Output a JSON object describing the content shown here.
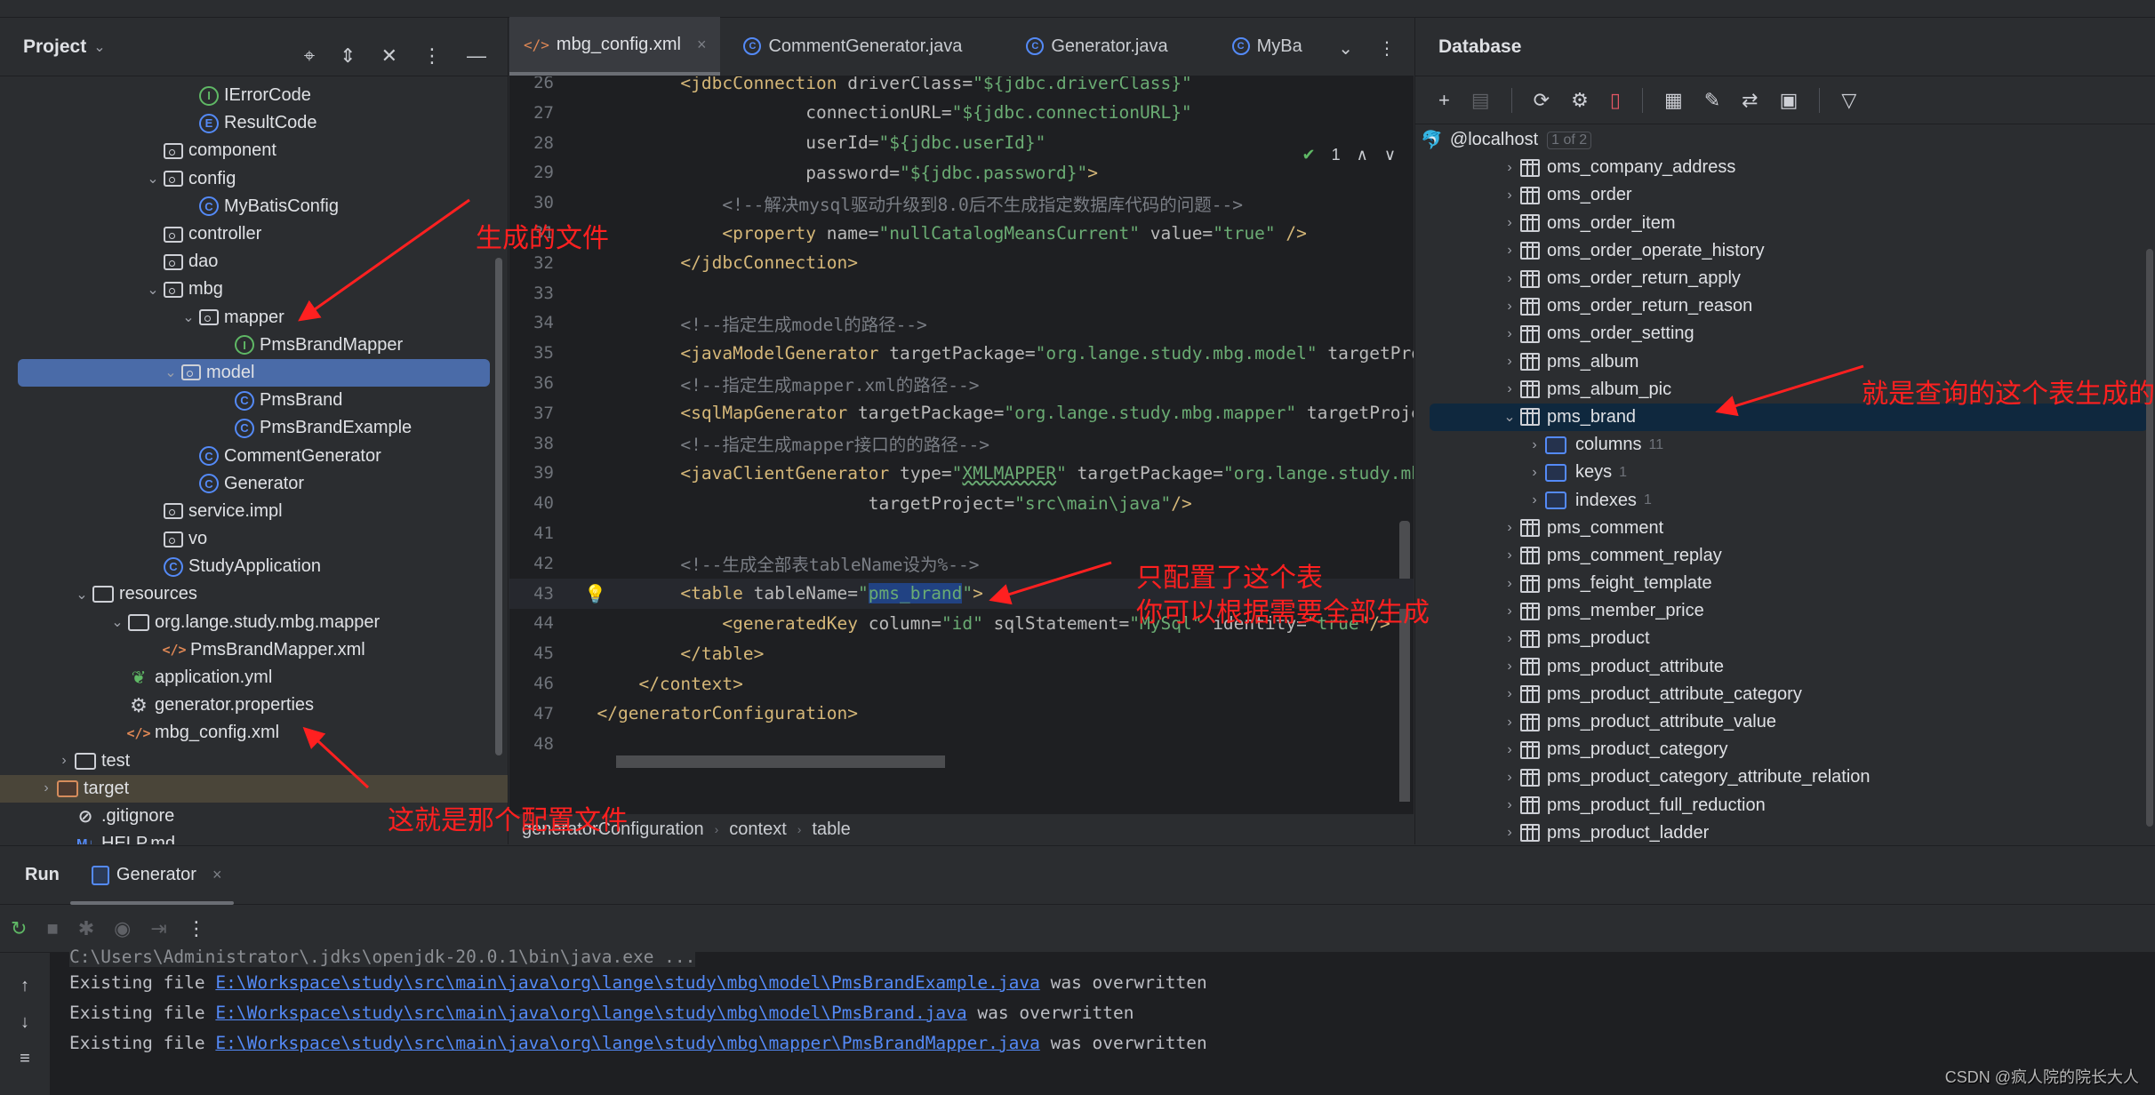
{
  "project_panel": {
    "title": "Project",
    "tree": [
      {
        "label": "IErrorCode",
        "icon": "interface-icon",
        "glyph": "I",
        "depth": 4,
        "arrow": ""
      },
      {
        "label": "ResultCode",
        "icon": "enum-icon",
        "glyph": "E",
        "depth": 4,
        "arrow": ""
      },
      {
        "label": "component",
        "icon": "package-icon",
        "depth": 3,
        "arrow": ""
      },
      {
        "label": "config",
        "icon": "package-icon",
        "depth": 3,
        "arrow": "down"
      },
      {
        "label": "MyBatisConfig",
        "icon": "class-icon",
        "glyph": "C",
        "depth": 4,
        "arrow": ""
      },
      {
        "label": "controller",
        "icon": "package-icon",
        "depth": 3,
        "arrow": ""
      },
      {
        "label": "dao",
        "icon": "package-icon",
        "depth": 3,
        "arrow": ""
      },
      {
        "label": "mbg",
        "icon": "package-icon",
        "depth": 3,
        "arrow": "down"
      },
      {
        "label": "mapper",
        "icon": "package-icon",
        "depth": 4,
        "arrow": "down"
      },
      {
        "label": "PmsBrandMapper",
        "icon": "interface-icon",
        "glyph": "I",
        "depth": 5,
        "arrow": ""
      },
      {
        "label": "model",
        "icon": "package-icon",
        "depth": 4,
        "arrow": "down",
        "selected": true
      },
      {
        "label": "PmsBrand",
        "icon": "class-icon",
        "glyph": "C",
        "depth": 5,
        "arrow": ""
      },
      {
        "label": "PmsBrandExample",
        "icon": "class-icon",
        "glyph": "C",
        "depth": 5,
        "arrow": ""
      },
      {
        "label": "CommentGenerator",
        "icon": "class-icon",
        "glyph": "C",
        "depth": 4,
        "arrow": ""
      },
      {
        "label": "Generator",
        "icon": "class-icon",
        "glyph": "C",
        "depth": 4,
        "arrow": ""
      },
      {
        "label": "service.impl",
        "icon": "package-icon",
        "depth": 3,
        "arrow": ""
      },
      {
        "label": "vo",
        "icon": "package-icon",
        "depth": 3,
        "arrow": ""
      },
      {
        "label": "StudyApplication",
        "icon": "spring-class-icon",
        "glyph": "C",
        "depth": 3,
        "arrow": ""
      },
      {
        "label": "resources",
        "icon": "resources-folder-icon",
        "depth": 1,
        "arrow": "down"
      },
      {
        "label": "org.lange.study.mbg.mapper",
        "icon": "folder-icon",
        "depth": 2,
        "arrow": "down"
      },
      {
        "label": "PmsBrandMapper.xml",
        "icon": "xml-file-icon",
        "depth": 3,
        "arrow": ""
      },
      {
        "label": "application.yml",
        "icon": "spring-yml-icon",
        "depth": 2,
        "arrow": ""
      },
      {
        "label": "generator.properties",
        "icon": "properties-gear-icon",
        "depth": 2,
        "arrow": ""
      },
      {
        "label": "mbg_config.xml",
        "icon": "xml-file-icon",
        "depth": 2,
        "arrow": ""
      },
      {
        "label": "test",
        "icon": "folder-icon",
        "depth": 0.5,
        "arrow": "right"
      },
      {
        "label": "target",
        "icon": "excluded-folder-icon",
        "depth": 0,
        "arrow": "right",
        "target": true
      },
      {
        "label": ".gitignore",
        "icon": "ignore-file-icon",
        "depth": 0.5,
        "arrow": ""
      },
      {
        "label": "HELP.md",
        "icon": "markdown-icon",
        "depth": 0.5,
        "arrow": ""
      }
    ]
  },
  "editor": {
    "tabs": [
      {
        "label": "mbg_config.xml",
        "icon": "xml-file-icon",
        "active": true,
        "closable": true
      },
      {
        "label": "CommentGenerator.java",
        "icon": "class-icon",
        "active": false
      },
      {
        "label": "Generator.java",
        "icon": "class-icon",
        "active": false
      },
      {
        "label": "MyBa",
        "icon": "class-icon",
        "active": false
      }
    ],
    "inspection_count": "1",
    "current_line": 43,
    "lines": [
      {
        "n": "26",
        "indent": 2,
        "segs": [
          [
            "tag",
            "<jdbcConnection "
          ],
          [
            "attr",
            "driverClass="
          ],
          [
            "str",
            "\"${jdbc.driverClass}\""
          ]
        ]
      },
      {
        "n": "27",
        "indent": 0,
        "pad": "                    ",
        "segs": [
          [
            "attr",
            "connectionURL="
          ],
          [
            "str",
            "\"${jdbc.connectionURL}\""
          ]
        ]
      },
      {
        "n": "28",
        "indent": 0,
        "pad": "                    ",
        "segs": [
          [
            "attr",
            "userId="
          ],
          [
            "str",
            "\"${jdbc.userId}\""
          ]
        ]
      },
      {
        "n": "29",
        "indent": 0,
        "pad": "                    ",
        "segs": [
          [
            "attr",
            "password="
          ],
          [
            "str",
            "\"${jdbc.password}\""
          ],
          [
            "tag",
            ">"
          ]
        ]
      },
      {
        "n": "30",
        "indent": 3,
        "segs": [
          [
            "cmt",
            "<!--解决mysql驱动升级到8.0后不生成指定数据库代码的问题-->"
          ]
        ]
      },
      {
        "n": "31",
        "indent": 3,
        "segs": [
          [
            "tag",
            "<property "
          ],
          [
            "attr",
            "name="
          ],
          [
            "str",
            "\"nullCatalogMeansCurrent\" "
          ],
          [
            "attr",
            "value="
          ],
          [
            "str",
            "\"true\" "
          ],
          [
            "tag",
            "/>"
          ]
        ]
      },
      {
        "n": "32",
        "indent": 2,
        "segs": [
          [
            "tag",
            "</jdbcConnection>"
          ]
        ]
      },
      {
        "n": "33",
        "indent": 0,
        "segs": []
      },
      {
        "n": "34",
        "indent": 2,
        "segs": [
          [
            "cmt",
            "<!--指定生成model的路径-->"
          ]
        ]
      },
      {
        "n": "35",
        "indent": 2,
        "segs": [
          [
            "tag",
            "<javaModelGenerator "
          ],
          [
            "attr",
            "targetPackage="
          ],
          [
            "str",
            "\"org.lange.study.mbg.model\" "
          ],
          [
            "attr",
            "targetProject=\"src\\main\\java\"/>"
          ]
        ]
      },
      {
        "n": "36",
        "indent": 2,
        "segs": [
          [
            "cmt",
            "<!--指定生成mapper.xml的路径-->"
          ]
        ]
      },
      {
        "n": "37",
        "indent": 2,
        "segs": [
          [
            "tag",
            "<sqlMapGenerator "
          ],
          [
            "attr",
            "targetPackage="
          ],
          [
            "str",
            "\"org.lange.study.mbg.mapper\" "
          ],
          [
            "attr",
            "targetProject=\"src\\main\\resources\"/>"
          ]
        ]
      },
      {
        "n": "38",
        "indent": 2,
        "segs": [
          [
            "cmt",
            "<!--指定生成mapper接口的的路径-->"
          ]
        ]
      },
      {
        "n": "39",
        "indent": 2,
        "segs": [
          [
            "tag",
            "<javaClientGenerator "
          ],
          [
            "attr",
            "type="
          ],
          [
            "str",
            "\""
          ],
          [
            "squig",
            "XMLMAPPER"
          ],
          [
            "str",
            "\" "
          ],
          [
            "attr",
            "targetPackage="
          ],
          [
            "str",
            "\"org.lange.study.mbg.mapper\""
          ]
        ]
      },
      {
        "n": "40",
        "indent": 0,
        "pad": "                          ",
        "segs": [
          [
            "attr",
            "targetProject="
          ],
          [
            "str",
            "\"src\\main\\java\""
          ],
          [
            "tag",
            "/>"
          ]
        ]
      },
      {
        "n": "41",
        "indent": 0,
        "segs": []
      },
      {
        "n": "42",
        "indent": 2,
        "segs": [
          [
            "cmt",
            "<!--生成全部表tableName设为%-->"
          ]
        ]
      },
      {
        "n": "43",
        "indent": 2,
        "segs": [
          [
            "tag",
            "<table "
          ],
          [
            "attr",
            "tableName="
          ],
          [
            "str",
            "\""
          ],
          [
            "sel",
            "pms_brand"
          ],
          [
            "str",
            "\""
          ],
          [
            "tag",
            ">"
          ]
        ]
      },
      {
        "n": "44",
        "indent": 3,
        "segs": [
          [
            "tag",
            "<generatedKey "
          ],
          [
            "attr",
            "column="
          ],
          [
            "str",
            "\"id\" "
          ],
          [
            "attr",
            "sqlStatement="
          ],
          [
            "str",
            "\"MySql\" "
          ],
          [
            "attr",
            "identity="
          ],
          [
            "str",
            "\"true\""
          ],
          [
            "tag",
            "/>"
          ]
        ]
      },
      {
        "n": "45",
        "indent": 2,
        "segs": [
          [
            "tag",
            "</table>"
          ]
        ]
      },
      {
        "n": "46",
        "indent": 1,
        "segs": [
          [
            "tag",
            "</context>"
          ]
        ]
      },
      {
        "n": "47",
        "indent": 0,
        "segs": [
          [
            "tag",
            "</generatorConfiguration>"
          ]
        ]
      },
      {
        "n": "48",
        "indent": 0,
        "segs": []
      }
    ],
    "breadcrumb": [
      "generatorConfiguration",
      "context",
      "table"
    ]
  },
  "database_panel": {
    "title": "Database",
    "connection": "@localhost",
    "connection_badge": "1 of 2",
    "tables": [
      {
        "label": "oms_company_address"
      },
      {
        "label": "oms_order"
      },
      {
        "label": "oms_order_item"
      },
      {
        "label": "oms_order_operate_history"
      },
      {
        "label": "oms_order_return_apply"
      },
      {
        "label": "oms_order_return_reason"
      },
      {
        "label": "oms_order_setting"
      },
      {
        "label": "pms_album"
      },
      {
        "label": "pms_album_pic"
      },
      {
        "label": "pms_brand",
        "expanded": true,
        "children": [
          {
            "label": "columns",
            "count": "11"
          },
          {
            "label": "keys",
            "count": "1"
          },
          {
            "label": "indexes",
            "count": "1"
          }
        ]
      },
      {
        "label": "pms_comment"
      },
      {
        "label": "pms_comment_replay"
      },
      {
        "label": "pms_feight_template"
      },
      {
        "label": "pms_member_price"
      },
      {
        "label": "pms_product"
      },
      {
        "label": "pms_product_attribute"
      },
      {
        "label": "pms_product_attribute_category"
      },
      {
        "label": "pms_product_attribute_value"
      },
      {
        "label": "pms_product_category"
      },
      {
        "label": "pms_product_category_attribute_relation"
      },
      {
        "label": "pms_product_full_reduction"
      },
      {
        "label": "pms_product_ladder"
      }
    ]
  },
  "run_panel": {
    "title": "Run",
    "tab_label": "Generator",
    "command_line": "C:\\Users\\Administrator\\.jdks\\openjdk-20.0.1\\bin\\java.exe ...",
    "output": [
      {
        "prefix": "Existing file ",
        "path": "E:\\Workspace\\study\\src\\main\\java\\org\\lange\\study\\mbg\\model\\PmsBrandExample.java",
        "suffix": " was overwritten"
      },
      {
        "prefix": "Existing file ",
        "path": "E:\\Workspace\\study\\src\\main\\java\\org\\lange\\study\\mbg\\model\\PmsBrand.java",
        "suffix": " was overwritten"
      },
      {
        "prefix": "Existing file ",
        "path": "E:\\Workspace\\study\\src\\main\\java\\org\\lange\\study\\mbg\\mapper\\PmsBrandMapper.java",
        "suffix": " was overwritten"
      }
    ]
  },
  "annotations": {
    "generated_files": "生成的文件",
    "config_file": "这就是那个配置文件",
    "only_this_table_1": "只配置了这个表",
    "only_this_table_2": "你可以根据需要全部生成",
    "queried_table": "就是查询的这个表生成的"
  },
  "watermark": "CSDN @疯人院的院长大人",
  "colors": {
    "accent_selection": "#4a6ba8",
    "db_selection": "#0f283e",
    "annotation_red": "#ff2020",
    "link_blue": "#548af7"
  }
}
